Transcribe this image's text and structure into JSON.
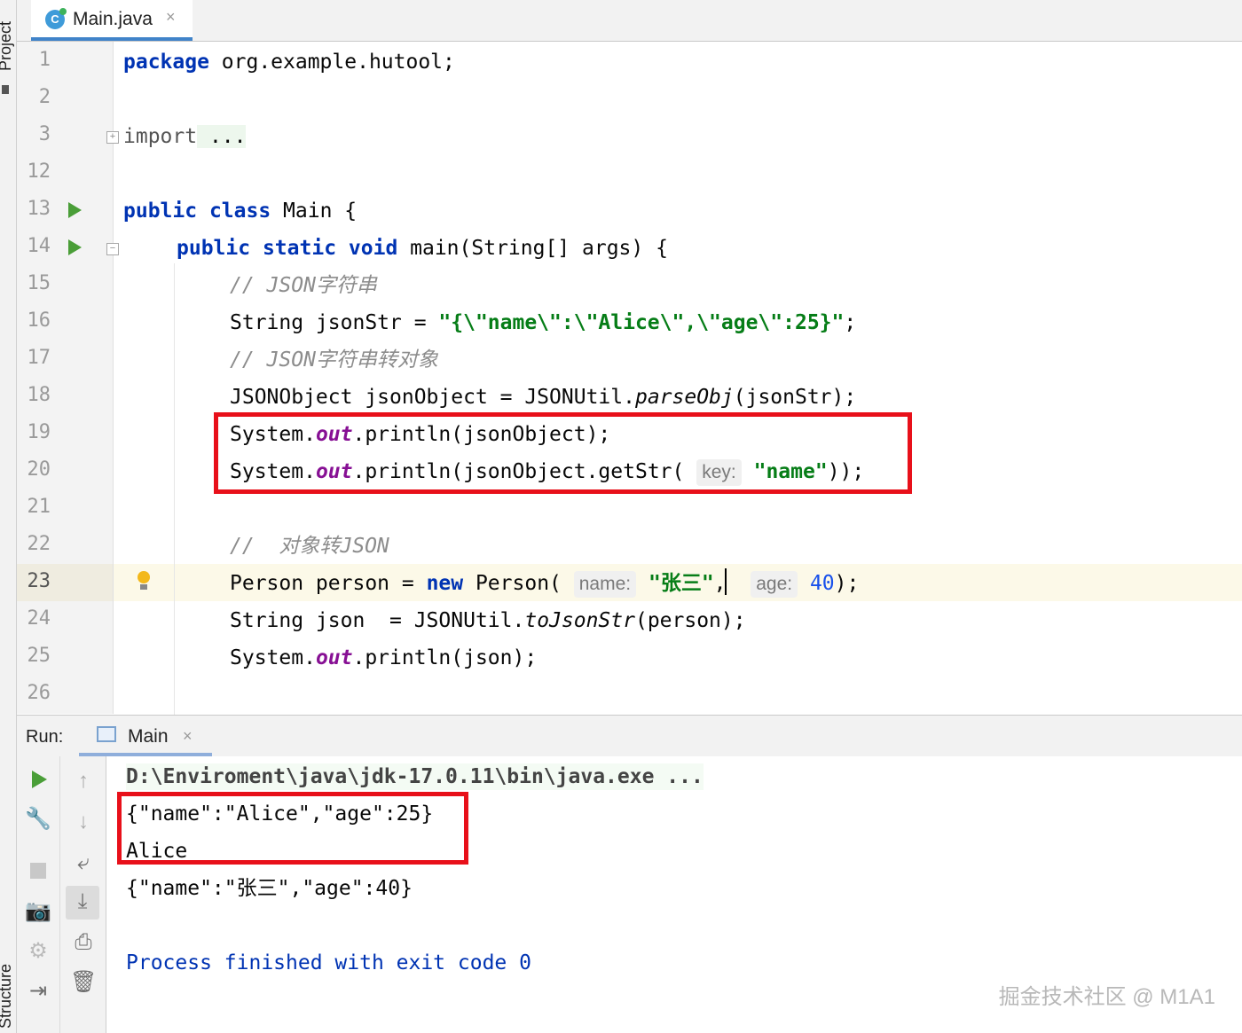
{
  "tool_windows": {
    "top_left": "Project",
    "bottom_left": "Structure"
  },
  "editor_tab": {
    "icon_letter": "C",
    "label": "Main.java",
    "close": "×"
  },
  "gutter": {
    "line_numbers": [
      "1",
      "2",
      "3",
      "12",
      "13",
      "14",
      "15",
      "16",
      "17",
      "18",
      "19",
      "20",
      "21",
      "22",
      "23",
      "24",
      "25",
      "26"
    ]
  },
  "code": {
    "l1": {
      "kw": "package",
      "rest": " org.example.hutool;"
    },
    "l3": {
      "kw": "import",
      "rest": " ..."
    },
    "l13": {
      "kw1": "public",
      "kw2": "class",
      "rest": " Main {"
    },
    "l14": {
      "kw1": "public",
      "kw2": "static",
      "kw3": "void",
      "rest": " main(String[] args) {"
    },
    "l15": {
      "comment": "// JSON字符串"
    },
    "l16": {
      "pre": "String jsonStr = ",
      "str": "\"{\\\"name\\\":\\\"Alice\\\",\\\"age\\\":25}\"",
      "post": ";"
    },
    "l17": {
      "comment": "// JSON字符串转对象"
    },
    "l18": {
      "pre": "JSONObject jsonObject = JSONUtil.",
      "method": "parseObj",
      "post": "(jsonStr);"
    },
    "l19": {
      "pre": "System.",
      "field": "out",
      "post": ".println(jsonObject);"
    },
    "l20": {
      "pre": "System.",
      "field": "out",
      "mid": ".println(jsonObject.getStr( ",
      "hint": "key:",
      "str": "\"name\"",
      "post": "));"
    },
    "l22": {
      "comment": "//  对象转JSON"
    },
    "l23": {
      "pre": "Person person = ",
      "kw": "new",
      "mid": " Person( ",
      "hint1": "name:",
      "str": "\"张三\"",
      "sep": ",  ",
      "hint2": "age:",
      "num": "40",
      "post": ");"
    },
    "l24": {
      "pre": "String json  = JSONUtil.",
      "method": "toJsonStr",
      "post": "(person);"
    },
    "l25": {
      "pre": "System.",
      "field": "out",
      "post": ".println(json);"
    }
  },
  "run_panel": {
    "label": "Run:",
    "tab_label": "Main",
    "tab_close": "×"
  },
  "console": {
    "command": "D:\\Enviroment\\java\\jdk-17.0.11\\bin\\java.exe ...",
    "lines": [
      "{\"name\":\"Alice\",\"age\":25}",
      "Alice",
      "{\"name\":\"张三\",\"age\":40}"
    ],
    "process": "Process finished with exit code 0"
  },
  "watermark": "掘金技术社区 @ M1A1",
  "colors": {
    "keyword": "#0033b3",
    "string": "#067d17",
    "comment": "#8c8c8c",
    "highlight_box": "#e8101a",
    "run_arrow": "#4a9e38"
  }
}
